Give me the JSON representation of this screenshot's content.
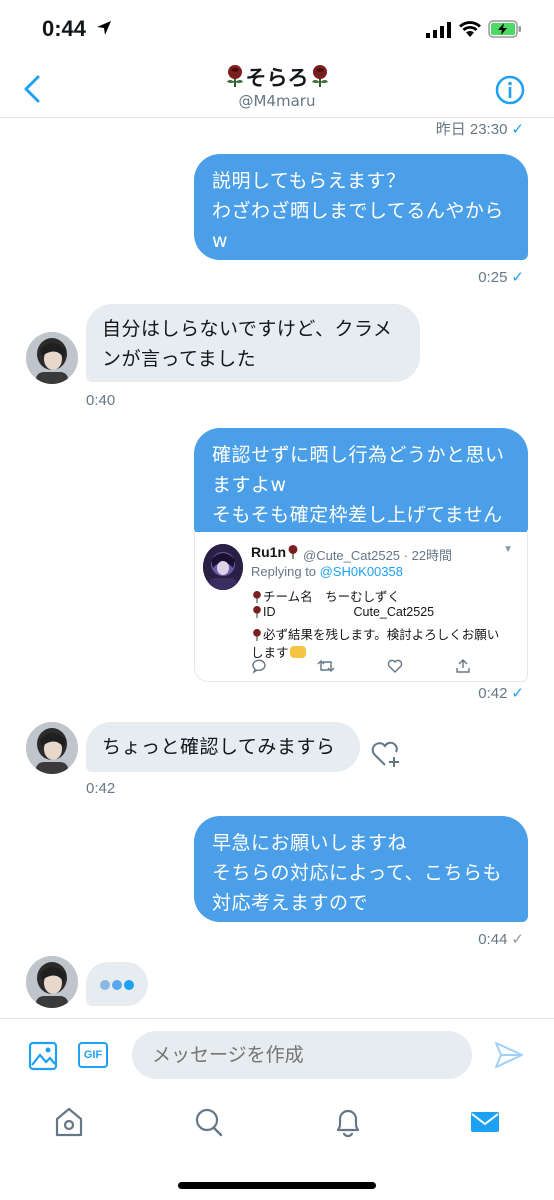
{
  "status_bar": {
    "time": "0:44"
  },
  "header": {
    "name": "そらろ",
    "handle": "@M4maru"
  },
  "messages": [
    {
      "kind": "timestamp",
      "text": "昨日 23:30",
      "check": "✓"
    },
    {
      "kind": "out",
      "text": "説明してもらえます？\nわざわざ晒しまでしてるんやから\nw",
      "time": "0:25",
      "check": "✓"
    },
    {
      "kind": "in",
      "text": "自分はしらないですけど、クラメ\nンが言ってました",
      "time": "0:40"
    },
    {
      "kind": "out",
      "text": "確認せずに晒し行為どうかと思い\nますよw\nそもそも確定枠差し上げてません",
      "time": "0:42",
      "check": "✓"
    },
    {
      "kind": "in",
      "text": "ちょっと確認してみますら",
      "time": "0:42"
    },
    {
      "kind": "out",
      "text": "早急にお願いしますね\nそちらの対応によって、こちらも\n対応考えますので",
      "time": "0:44",
      "check": "✓"
    }
  ],
  "quoted_tweet": {
    "name": "Ru1n",
    "handle_time": "@Cute_Cat2525 · 22時間",
    "replying_prefix": "Replying to ",
    "replying_to": "@SH0K00358",
    "line1": "チーム名　ちーむしずく",
    "line2_label": "ID",
    "line2_value": "Cute_Cat2525",
    "line3": "必ず結果を残します。検討よろしくお願い",
    "line4": "します"
  },
  "composer": {
    "placeholder": "メッセージを作成"
  },
  "colors": {
    "accent": "#1da1f2",
    "outgoing_bubble": "#4a9fe8",
    "incoming_bubble": "#e6ecf0",
    "muted_text": "#657786"
  },
  "icons": [
    "location-arrow-icon",
    "signal-icon",
    "wifi-icon",
    "battery-icon",
    "back-chevron-icon",
    "info-icon",
    "rose-emoji-icon",
    "image-icon",
    "gif-icon",
    "send-icon",
    "home-icon",
    "search-icon",
    "bell-icon",
    "mail-icon",
    "heart-add-icon",
    "reply-icon",
    "retweet-icon",
    "like-icon",
    "share-icon"
  ]
}
